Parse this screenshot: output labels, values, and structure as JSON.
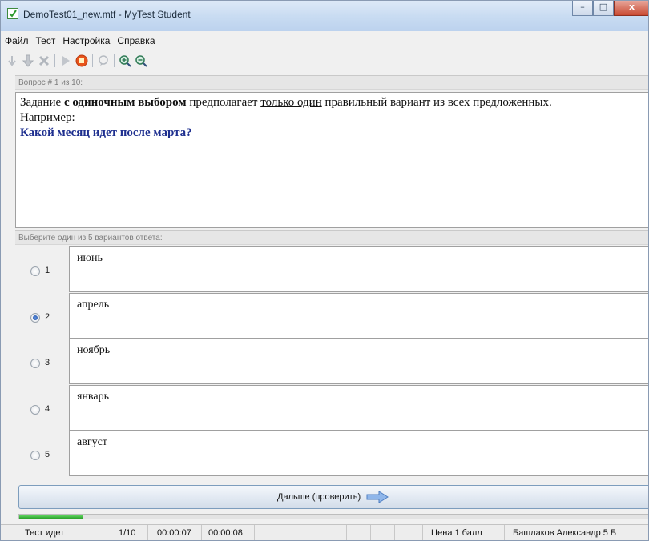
{
  "window": {
    "title": "DemoTest01_new.mtf - MyTest Student",
    "buttons": {
      "minimize": "–",
      "maximize": "□",
      "close": "x"
    }
  },
  "menu": [
    "Файл",
    "Тест",
    "Настройка",
    "Справка"
  ],
  "toolbar_icons": [
    "arrow-down-small-icon",
    "arrow-down-icon",
    "cancel-x-icon",
    "play-icon",
    "stop-icon",
    "feedback-icon",
    "zoom-in-icon",
    "zoom-out-icon"
  ],
  "question_header": "Вопрос # 1 из 10:",
  "question": {
    "part1": "Задание ",
    "bold": "с одиночным выбором",
    "part2": " предполагает ",
    "underline": "только один",
    "part3": " правильный вариант из всех предложенных.",
    "line2": "Например:",
    "prompt": "Какой месяц идет после марта?"
  },
  "answers_header": "Выберите один из 5 вариантов ответа:",
  "answers": [
    {
      "num": "1",
      "text": "июнь",
      "checked": false
    },
    {
      "num": "2",
      "text": "апрель",
      "checked": true
    },
    {
      "num": "3",
      "text": "ноябрь",
      "checked": false
    },
    {
      "num": "4",
      "text": "январь",
      "checked": false
    },
    {
      "num": "5",
      "text": "август",
      "checked": false
    }
  ],
  "next_button": "Дальше (проверить)",
  "progress_fraction": 0.1,
  "status": {
    "state": "Тест идет",
    "counter": "1/10",
    "elapsed": "00:00:07",
    "question_time": "00:00:08",
    "price": "Цена 1 балл",
    "student": "Башлаков Александр 5 Б"
  },
  "colors": {
    "prompt": "#1e2f8f",
    "progress": "#2aa02a",
    "stop_icon": "#e8531a"
  }
}
